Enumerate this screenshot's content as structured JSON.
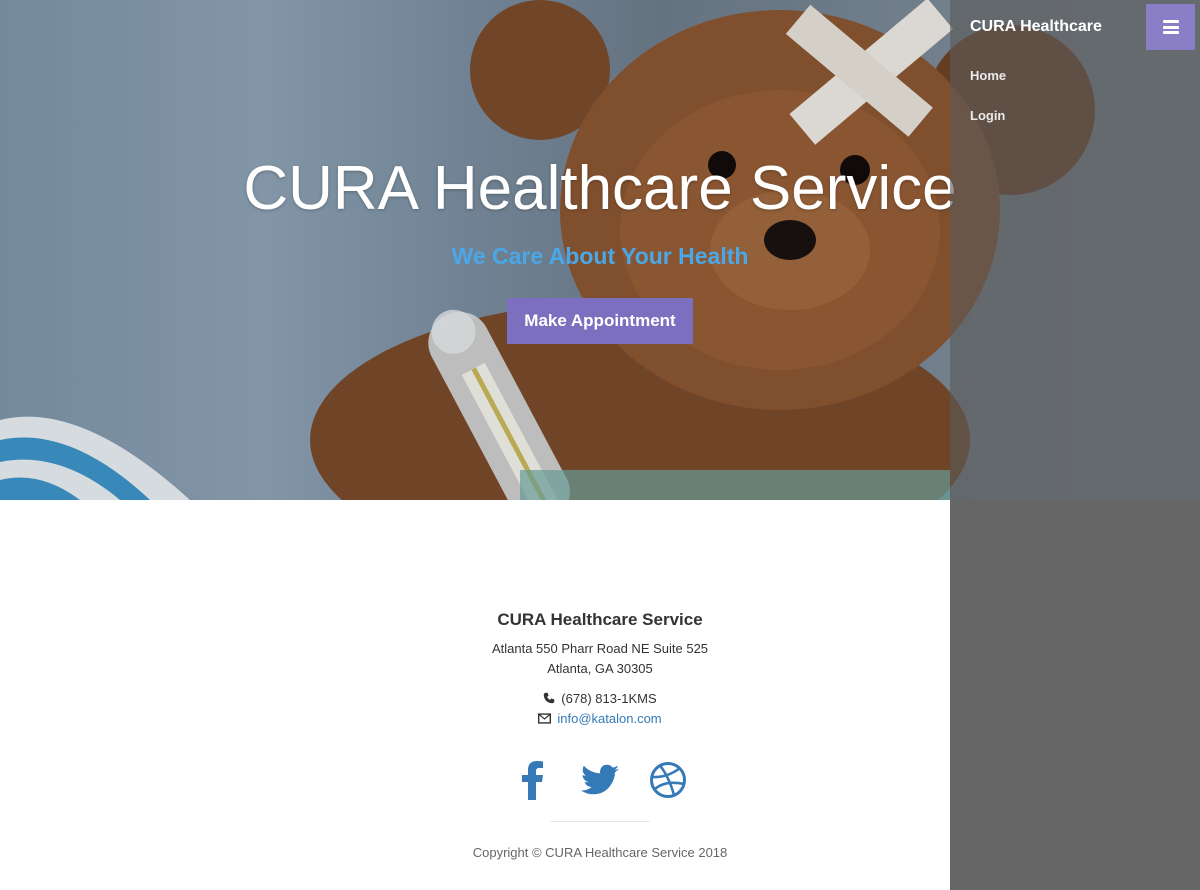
{
  "hero": {
    "title": "CURA Healthcare Service",
    "subtitle": "We Care About Your Health",
    "cta_label": "Make Appointment"
  },
  "sidebar": {
    "brand": "CURA Healthcare",
    "items": [
      {
        "label": "Home"
      },
      {
        "label": "Login"
      }
    ],
    "toggle_icon": "bars-icon"
  },
  "footer": {
    "title": "CURA Healthcare Service",
    "address_line1": "Atlanta 550 Pharr Road NE Suite 525",
    "address_line2": "Atlanta, GA 30305",
    "phone": "(678) 813-1KMS",
    "email": "info@katalon.com",
    "social": [
      "facebook-icon",
      "twitter-icon",
      "dribbble-icon"
    ],
    "copyright": "Copyright © CURA Healthcare Service 2018"
  },
  "colors": {
    "accent": "#7d6fbf",
    "subtitle": "#4aa8e8",
    "link": "#337ab7",
    "sidebar_overlay": "#666666"
  }
}
